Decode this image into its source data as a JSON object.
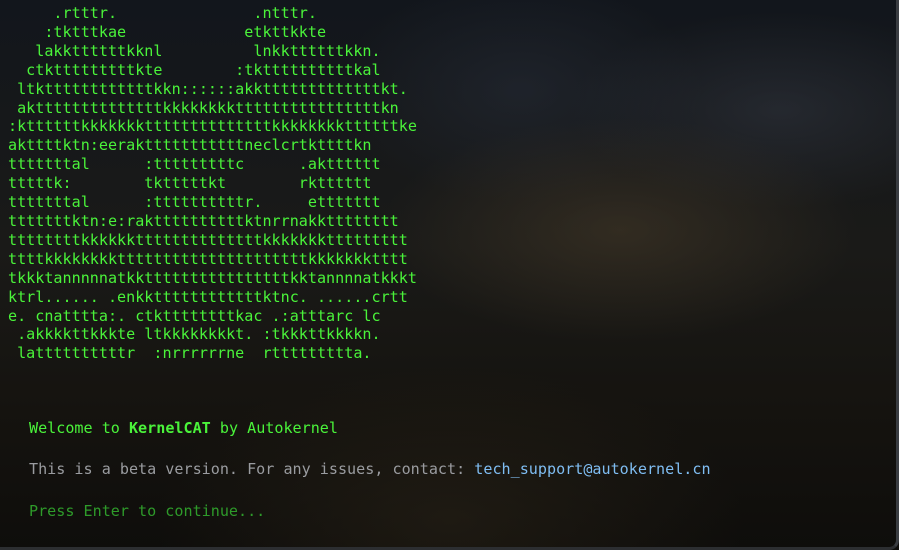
{
  "ascii_art": [
    "     .rtttr.               .ntttr.",
    "    :tktttkae             etkttkkte",
    "   lakkttttttkknl          lnkkttttttkkn.",
    "  ctktttttttttkte        :tkttttttttttkal",
    " ltkttttttttttttkkn::::::akktttttttttttttkt.",
    " akttttttttttttttkkkkkkkkttttttttttttttttkn",
    ":kttttttkkkkkkkttttttttttttttkkkkkkkkttttttke",
    "akttttktn:eeraktttttttttttneclcrtkttttkn",
    "tttttttal      :tttttttttc      .aktttttt",
    "tttttk:        tktttttkt        rktttttt",
    "tttttttal      :ttttttttttr.     ettttttt",
    "tttttttktn:e:rakttttttttttktnrrnakktttttttt",
    "ttttttttkkkkkkttttttttttttttkkkkkkkttttttttt",
    "ttttkkkkkkkktttttttttttttttttttttkkkkkkktttt",
    "tkkktannnnnatkkttttttttttttttttkktannnnatkkkt",
    "ktrl...... .enkkttttttttttttktnc. ......crtt",
    "e. cnatttta:. ctkttttttttkac .:atttarc lc",
    " .akkkkttkkkte ltkkkkkkkkt. :tkkkttkkkkn.",
    " lattttttttttr  :nrrrrrrne  rttttttttta."
  ],
  "welcome": {
    "prefix": "Welcome to ",
    "brand": "KernelCAT",
    "suffix": " by Autokernel"
  },
  "notice": {
    "text": "This is a beta version. For any issues, contact: ",
    "email": "tech_support@autokernel.cn"
  },
  "prompt": "Press Enter to continue...",
  "colors": {
    "ascii_green": "#4af33a",
    "dim_green": "#2e9b2a",
    "gray_text": "#9a9ca0",
    "link_blue": "#7fbdf2"
  }
}
